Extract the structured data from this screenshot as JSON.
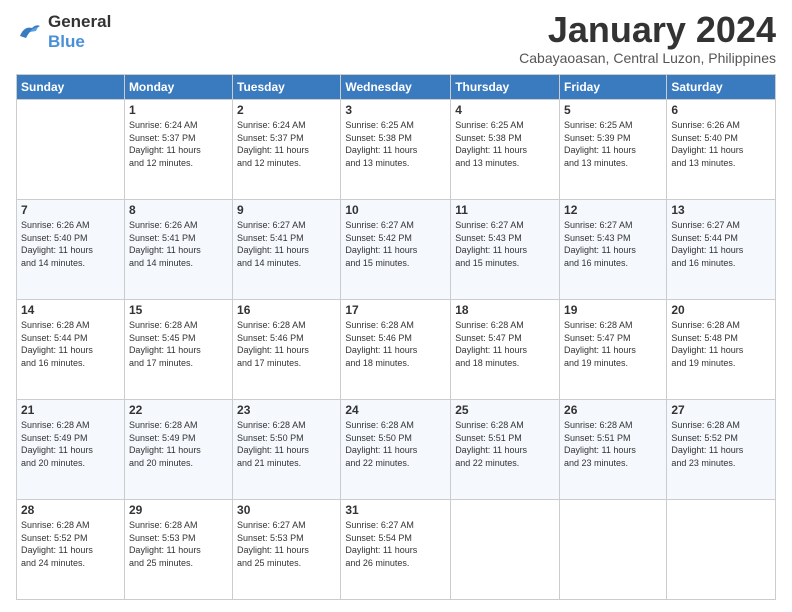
{
  "logo": {
    "line1": "General",
    "line2": "Blue"
  },
  "title": "January 2024",
  "subtitle": "Cabayaoasan, Central Luzon, Philippines",
  "days_header": [
    "Sunday",
    "Monday",
    "Tuesday",
    "Wednesday",
    "Thursday",
    "Friday",
    "Saturday"
  ],
  "weeks": [
    [
      {
        "num": "",
        "info": ""
      },
      {
        "num": "1",
        "info": "Sunrise: 6:24 AM\nSunset: 5:37 PM\nDaylight: 11 hours\nand 12 minutes."
      },
      {
        "num": "2",
        "info": "Sunrise: 6:24 AM\nSunset: 5:37 PM\nDaylight: 11 hours\nand 12 minutes."
      },
      {
        "num": "3",
        "info": "Sunrise: 6:25 AM\nSunset: 5:38 PM\nDaylight: 11 hours\nand 13 minutes."
      },
      {
        "num": "4",
        "info": "Sunrise: 6:25 AM\nSunset: 5:38 PM\nDaylight: 11 hours\nand 13 minutes."
      },
      {
        "num": "5",
        "info": "Sunrise: 6:25 AM\nSunset: 5:39 PM\nDaylight: 11 hours\nand 13 minutes."
      },
      {
        "num": "6",
        "info": "Sunrise: 6:26 AM\nSunset: 5:40 PM\nDaylight: 11 hours\nand 13 minutes."
      }
    ],
    [
      {
        "num": "7",
        "info": "Sunrise: 6:26 AM\nSunset: 5:40 PM\nDaylight: 11 hours\nand 14 minutes."
      },
      {
        "num": "8",
        "info": "Sunrise: 6:26 AM\nSunset: 5:41 PM\nDaylight: 11 hours\nand 14 minutes."
      },
      {
        "num": "9",
        "info": "Sunrise: 6:27 AM\nSunset: 5:41 PM\nDaylight: 11 hours\nand 14 minutes."
      },
      {
        "num": "10",
        "info": "Sunrise: 6:27 AM\nSunset: 5:42 PM\nDaylight: 11 hours\nand 15 minutes."
      },
      {
        "num": "11",
        "info": "Sunrise: 6:27 AM\nSunset: 5:43 PM\nDaylight: 11 hours\nand 15 minutes."
      },
      {
        "num": "12",
        "info": "Sunrise: 6:27 AM\nSunset: 5:43 PM\nDaylight: 11 hours\nand 16 minutes."
      },
      {
        "num": "13",
        "info": "Sunrise: 6:27 AM\nSunset: 5:44 PM\nDaylight: 11 hours\nand 16 minutes."
      }
    ],
    [
      {
        "num": "14",
        "info": "Sunrise: 6:28 AM\nSunset: 5:44 PM\nDaylight: 11 hours\nand 16 minutes."
      },
      {
        "num": "15",
        "info": "Sunrise: 6:28 AM\nSunset: 5:45 PM\nDaylight: 11 hours\nand 17 minutes."
      },
      {
        "num": "16",
        "info": "Sunrise: 6:28 AM\nSunset: 5:46 PM\nDaylight: 11 hours\nand 17 minutes."
      },
      {
        "num": "17",
        "info": "Sunrise: 6:28 AM\nSunset: 5:46 PM\nDaylight: 11 hours\nand 18 minutes."
      },
      {
        "num": "18",
        "info": "Sunrise: 6:28 AM\nSunset: 5:47 PM\nDaylight: 11 hours\nand 18 minutes."
      },
      {
        "num": "19",
        "info": "Sunrise: 6:28 AM\nSunset: 5:47 PM\nDaylight: 11 hours\nand 19 minutes."
      },
      {
        "num": "20",
        "info": "Sunrise: 6:28 AM\nSunset: 5:48 PM\nDaylight: 11 hours\nand 19 minutes."
      }
    ],
    [
      {
        "num": "21",
        "info": "Sunrise: 6:28 AM\nSunset: 5:49 PM\nDaylight: 11 hours\nand 20 minutes."
      },
      {
        "num": "22",
        "info": "Sunrise: 6:28 AM\nSunset: 5:49 PM\nDaylight: 11 hours\nand 20 minutes."
      },
      {
        "num": "23",
        "info": "Sunrise: 6:28 AM\nSunset: 5:50 PM\nDaylight: 11 hours\nand 21 minutes."
      },
      {
        "num": "24",
        "info": "Sunrise: 6:28 AM\nSunset: 5:50 PM\nDaylight: 11 hours\nand 22 minutes."
      },
      {
        "num": "25",
        "info": "Sunrise: 6:28 AM\nSunset: 5:51 PM\nDaylight: 11 hours\nand 22 minutes."
      },
      {
        "num": "26",
        "info": "Sunrise: 6:28 AM\nSunset: 5:51 PM\nDaylight: 11 hours\nand 23 minutes."
      },
      {
        "num": "27",
        "info": "Sunrise: 6:28 AM\nSunset: 5:52 PM\nDaylight: 11 hours\nand 23 minutes."
      }
    ],
    [
      {
        "num": "28",
        "info": "Sunrise: 6:28 AM\nSunset: 5:52 PM\nDaylight: 11 hours\nand 24 minutes."
      },
      {
        "num": "29",
        "info": "Sunrise: 6:28 AM\nSunset: 5:53 PM\nDaylight: 11 hours\nand 25 minutes."
      },
      {
        "num": "30",
        "info": "Sunrise: 6:27 AM\nSunset: 5:53 PM\nDaylight: 11 hours\nand 25 minutes."
      },
      {
        "num": "31",
        "info": "Sunrise: 6:27 AM\nSunset: 5:54 PM\nDaylight: 11 hours\nand 26 minutes."
      },
      {
        "num": "",
        "info": ""
      },
      {
        "num": "",
        "info": ""
      },
      {
        "num": "",
        "info": ""
      }
    ]
  ]
}
